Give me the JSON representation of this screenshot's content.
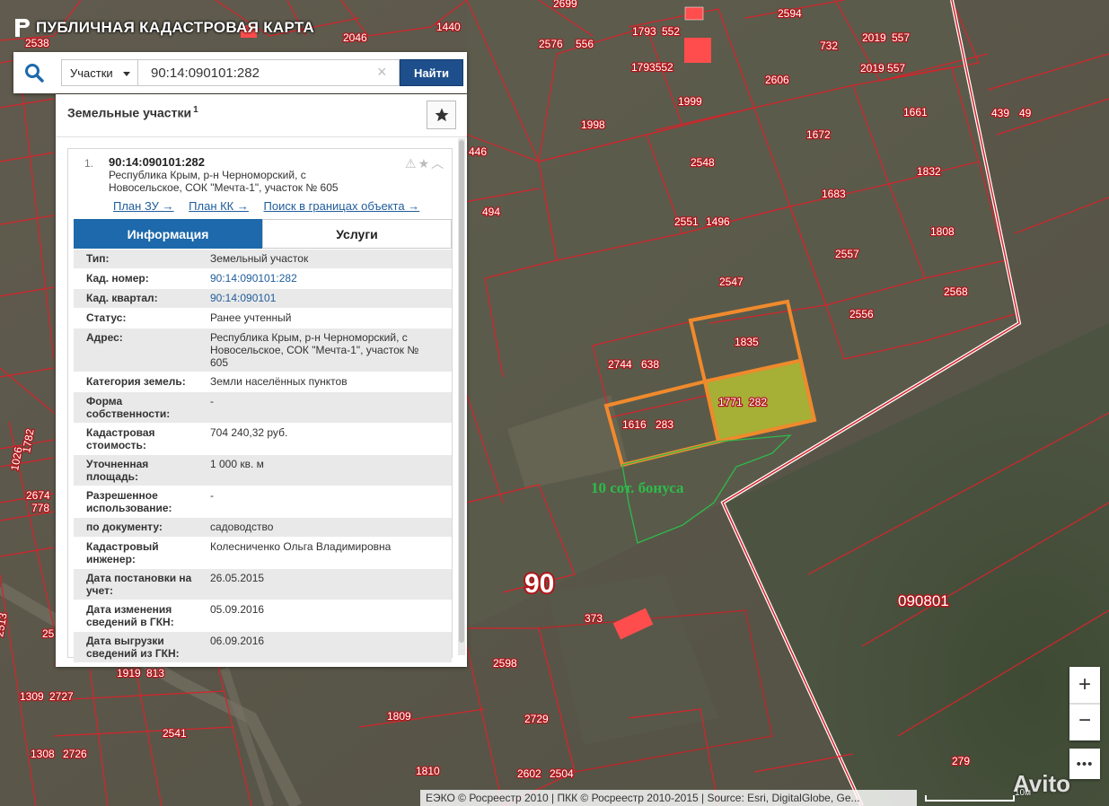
{
  "app": {
    "title": "ПУБЛИЧНАЯ КАДАСТРОВАЯ КАРТА"
  },
  "search": {
    "type_label": "Участки",
    "query": "90:14:090101:282",
    "button_label": "Найти"
  },
  "panel": {
    "title": "Земельные участки",
    "count": "1"
  },
  "result": {
    "number": "1.",
    "cad_number": "90:14:090101:282",
    "address_line1": "Республика Крым, р-н Черноморский, с",
    "address_line2": "Новосельское, СОК \"Мечта-1\", участок № 605",
    "links": [
      "План ЗУ →",
      "План КК →",
      "Поиск в границах объекта →"
    ],
    "tabs": [
      "Информация",
      "Услуги"
    ],
    "details": [
      {
        "label": "Тип:",
        "value": "Земельный участок"
      },
      {
        "label": "Кад. номер:",
        "value": "90:14:090101:282",
        "link": true
      },
      {
        "label": "Кад. квартал:",
        "value": "90:14:090101",
        "link": true
      },
      {
        "label": "Статус:",
        "value": "Ранее учтенный"
      },
      {
        "label": "Адрес:",
        "value": "Республика Крым, р-н Черноморский, с Новосельское, СОК \"Мечта-1\", участок № 605"
      },
      {
        "label": "Категория земель:",
        "value": "Земли населённых пунктов"
      },
      {
        "label": "Форма собственности:",
        "value": "-"
      },
      {
        "label": "Кадастровая стоимость:",
        "value": "704 240,32 руб."
      },
      {
        "label": "Уточненная площадь:",
        "value": "1 000 кв. м"
      },
      {
        "label": "Разрешенное использование:",
        "value": "-"
      },
      {
        "label": "по документу:",
        "value": "садоводство"
      },
      {
        "label": "Кадастровый инженер:",
        "value": "Колесниченко Ольга Владимировна"
      },
      {
        "label": "Дата постановки на учет:",
        "value": "26.05.2015"
      },
      {
        "label": "Дата изменения сведений в ГКН:",
        "value": "05.09.2016"
      },
      {
        "label": "Дата выгрузки сведений из ГКН:",
        "value": "06.09.2016"
      }
    ]
  },
  "map": {
    "parcel_labels": [
      "2538",
      "2046",
      "1440",
      "2699",
      "2594",
      "1793",
      "552",
      "2576",
      "556",
      "1793552",
      "732",
      "2019",
      "557",
      "2606",
      "2019 557",
      "1998",
      "1999",
      "1661",
      "439",
      "49",
      "446",
      "1672",
      "2548",
      "1832",
      "494",
      "1683",
      "2551",
      "1496",
      "1808",
      "2557",
      "2547",
      "2568",
      "2556",
      "1835",
      "2744",
      "638",
      "1771",
      "282",
      "1616",
      "283",
      "373",
      "2598",
      "2729",
      "1809",
      "2541",
      "1919",
      "813",
      "1309",
      "2727",
      "1308",
      "2726",
      "1810",
      "2602",
      "2504",
      "279",
      "2674",
      "778",
      "1026",
      "1782",
      "2513",
      "25"
    ],
    "quarter_label": "090801",
    "district_label": "90",
    "annotation": "10 сот. бонуса"
  },
  "controls": {
    "zoom_in": "+",
    "zoom_out": "−",
    "more": "•••"
  },
  "footer": {
    "attribution": "ЕЭКО © Росреестр 2010 | ПКК © Росреестр 2010-2015 | Source: Esri, DigitalGlobe, Ge...",
    "scale": "10м"
  },
  "watermark": "Avito",
  "colors": {
    "parcel_border": "#d6242b",
    "highlight_border": "#f08a2c",
    "selected_fill": "#b9c431",
    "panel_blue": "#1d69ab",
    "button_blue": "#1e4f8c",
    "annotation_green": "#2dbb4a"
  }
}
